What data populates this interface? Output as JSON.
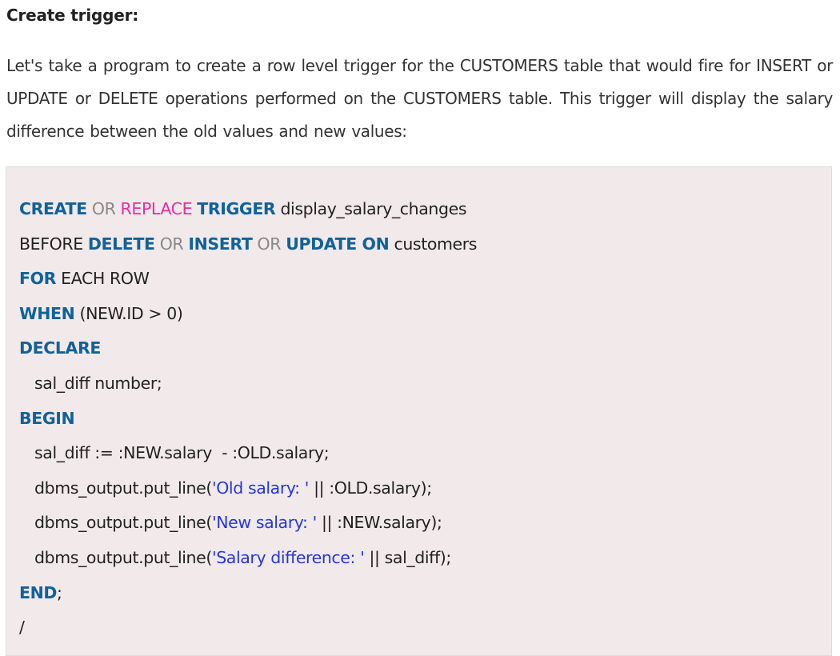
{
  "heading": "Create trigger:",
  "intro": "Let's take a program to create a row level trigger for the CUSTOMERS table that would fire for INSERT or UPDATE or DELETE operations performed on the CUSTOMERS table. This trigger will display the salary difference between the old values and new values:",
  "code": {
    "l1": {
      "create": "CREATE",
      "or": "OR",
      "replace": "REPLACE",
      "trigger": "TRIGGER",
      "name": "display_salary_changes"
    },
    "l2": {
      "before": "BEFORE",
      "delete": "DELETE",
      "or1": "OR",
      "insert": "INSERT",
      "or2": "OR",
      "update_on": "UPDATE ON",
      "table": "customers"
    },
    "l3": {
      "for": "FOR",
      "rest": "EACH ROW"
    },
    "l4": {
      "when": "WHEN",
      "cond": "(NEW.ID > 0)"
    },
    "l5": {
      "declare": "DECLARE"
    },
    "l6": {
      "text": "sal_diff number;"
    },
    "l7": {
      "begin": "BEGIN"
    },
    "l8": {
      "text": "sal_diff := :NEW.salary  - :OLD.salary;"
    },
    "l9": {
      "pre": "dbms_output.put_line(",
      "str": "'Old salary: '",
      "post": " || :OLD.salary);"
    },
    "l10": {
      "pre": "dbms_output.put_line(",
      "str": "'New salary: '",
      "post": " || :NEW.salary);"
    },
    "l11": {
      "pre": "dbms_output.put_line(",
      "str": "'Salary difference: '",
      "post": " || sal_diff);"
    },
    "l12": {
      "end": "END",
      "semi": ";"
    },
    "l13": {
      "text": "/"
    }
  },
  "colors": {
    "keyword": "#10629c",
    "operator": "#888888",
    "replace_keyword": "#ea2d9c",
    "string_literal": "#2637d6",
    "code_background": "#f1e9ea"
  }
}
